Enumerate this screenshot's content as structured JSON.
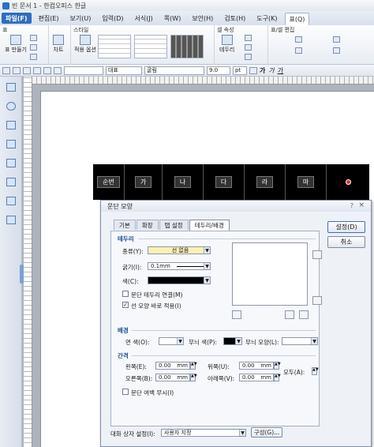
{
  "window": {
    "title": "빈 문서 1 - 한컴오피스 한글"
  },
  "menu": {
    "items": [
      "파일(F)",
      "편집(E)",
      "보기(U)",
      "입력(D)",
      "서식(J)",
      "쪽(W)",
      "보안(H)",
      "검토(H)",
      "도구(K)",
      "표(Q)"
    ]
  },
  "ribbon": {
    "groups": {
      "table": "표",
      "style": "스타일",
      "cell_props": "셀 속성",
      "table_edit": "표/셀 편집"
    },
    "buttons": {
      "make_table": "표 만들기",
      "chart": "차트",
      "apply_options": "적용 옵션",
      "border": "테두리"
    }
  },
  "format_toolbar": {
    "style_combo": "대표",
    "font_combo": "굴림",
    "size_combo": "9.0",
    "size_unit": "pt",
    "bold": "가",
    "italic": "가",
    "underline": "가"
  },
  "document": {
    "table_cells": [
      "순번",
      "가",
      "나",
      "다",
      "라",
      "마",
      ""
    ]
  },
  "dialog": {
    "title": "문단 모양",
    "help": "?",
    "close": "×",
    "tabs": [
      "기본",
      "확장",
      "탭 설정",
      "테두리/배경"
    ],
    "active_tab": "테두리/배경",
    "border": {
      "section": "테두리",
      "kind_label": "종류(Y):",
      "kind_value": "선 없음",
      "width_label": "굵기(I):",
      "width_value": "0.1mm",
      "color_label": "색(C):",
      "chk_connect": "문단 테두리 연결(M)",
      "chk_apply": "선 모양 바로 적용(I)",
      "chk_connect_checked": false,
      "chk_apply_checked": true
    },
    "background": {
      "section": "배경",
      "face_color_label": "면 색(O):",
      "pattern_color_label": "무늬 색(P):",
      "pattern_shape_label": "무늬 모양(L):"
    },
    "spacing": {
      "section": "간격",
      "left_label": "왼쪽(E):",
      "left_value": "0.00",
      "right_label": "오른쪽(B):",
      "right_value": "0.00",
      "top_label": "위쪽(U):",
      "top_value": "0.00",
      "bottom_label": "아래쪽(V):",
      "bottom_value": "0.00",
      "unit": "mm",
      "all_label": "모두(A):",
      "chk_ignore_margin": "문단 여백 무시(I)",
      "chk_ignore_margin_checked": false
    },
    "footer": {
      "setting_label": "대화 상자 설정(I):",
      "setting_value": "사용자 지정",
      "config_button": "구성(G)..."
    },
    "buttons": {
      "ok": "설정(D)",
      "cancel": "취소"
    }
  },
  "colors": {
    "menu_active": "#2f6dbf",
    "section_title": "#1c4a8f",
    "kind_field": "#fdf0b4"
  }
}
